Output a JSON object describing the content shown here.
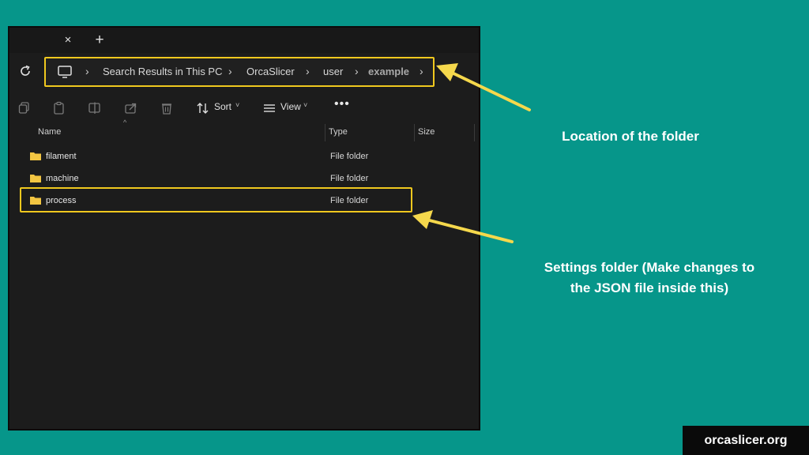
{
  "window": {
    "tab_close_glyph": "×",
    "tab_new_glyph": "+"
  },
  "address": {
    "crumbs": [
      "Search Results in This PC",
      "OrcaSlicer",
      "user",
      "example"
    ],
    "separator": "›"
  },
  "toolbar": {
    "sort_label": "Sort",
    "view_label": "View",
    "more_label": "•••",
    "caret": "˅"
  },
  "columns": {
    "name": "Name",
    "type": "Type",
    "size": "Size"
  },
  "files": [
    {
      "name": "filament",
      "type": "File folder"
    },
    {
      "name": "machine",
      "type": "File folder"
    },
    {
      "name": "process",
      "type": "File folder"
    }
  ],
  "annotations": {
    "location": "Location of the folder",
    "settings_line1": "Settings folder (Make changes to",
    "settings_line2": "the JSON file inside this)"
  },
  "brand": "orcaslicer.org",
  "colors": {
    "background": "#06968a",
    "highlight": "#f0c81e",
    "window": "#1c1c1c"
  }
}
